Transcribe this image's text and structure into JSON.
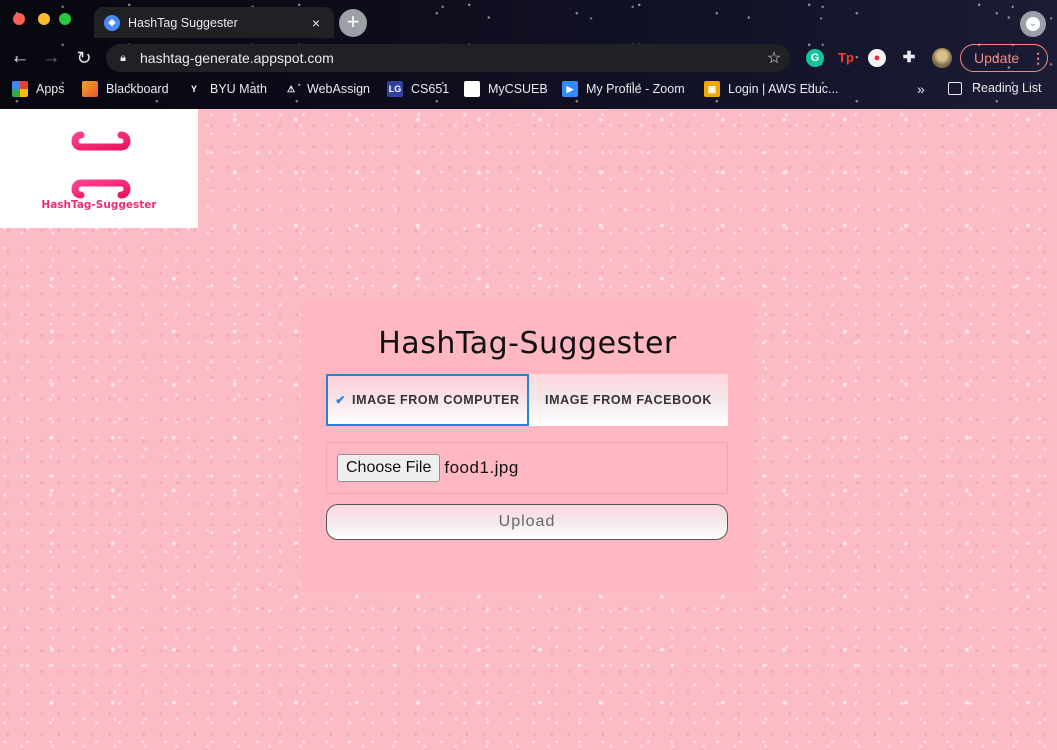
{
  "browser": {
    "tab_title": "HashTag Suggester",
    "tab_close": "×",
    "new_tab": "+",
    "url": "hashtag-generate.appspot.com",
    "update_label": "Update",
    "reading_list": "Reading List",
    "bookmarks": [
      {
        "label": "Apps",
        "icon": "apps-grid-icon"
      },
      {
        "label": "Blackboard",
        "icon": "blackboard-icon"
      },
      {
        "label": "BYU Math",
        "icon": "byu-icon"
      },
      {
        "label": "WebAssign",
        "icon": "webassign-icon"
      },
      {
        "label": "CS651",
        "icon": "cs651-icon"
      },
      {
        "label": "MyCSUEB",
        "icon": "mycsueb-icon"
      },
      {
        "label": "My Profile - Zoom",
        "icon": "zoom-icon"
      },
      {
        "label": "Login | AWS Educ...",
        "icon": "aws-icon"
      }
    ]
  },
  "page": {
    "logo_text": "HashTag-Suggester",
    "title": "HashTag-Suggester",
    "source_tabs": [
      {
        "label": "IMAGE FROM COMPUTER",
        "active": true
      },
      {
        "label": "IMAGE FROM FACEBOOK",
        "active": false
      }
    ],
    "choose_file_label": "Choose File",
    "file_name": "food1.jpg",
    "upload_label": "Upload"
  },
  "colors": {
    "page_background": "#fcbcc6",
    "card_background": "#ffb7c2",
    "active_tab_border": "#2684d6",
    "logo_pink": "#ee2a7b"
  }
}
